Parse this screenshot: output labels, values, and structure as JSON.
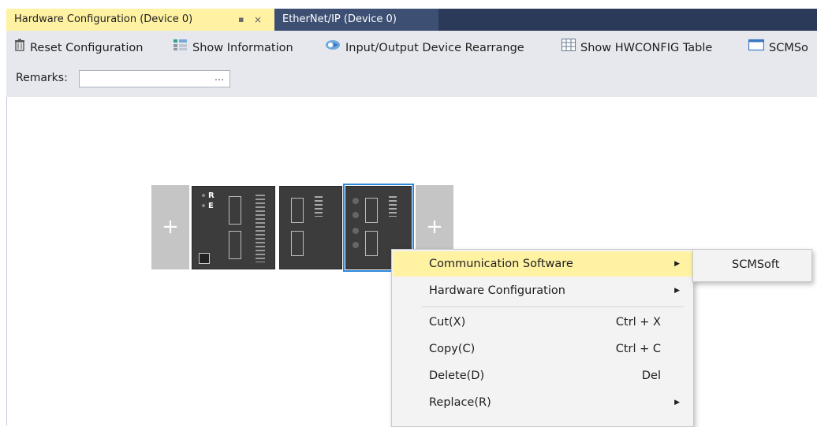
{
  "tabs": [
    {
      "label": "Hardware Configuration (Device 0)",
      "active": true,
      "pin": "▪",
      "close": "×"
    },
    {
      "label": "EtherNet/IP (Device 0)",
      "active": false
    }
  ],
  "toolbar": {
    "reset_label": "Reset Configuration",
    "show_info_label": "Show Information",
    "io_rearrange_label": "Input/Output Device Rearrange",
    "hwconfig_table_label": "Show HWCONFIG Table",
    "scmsoft_label": "SCMSo"
  },
  "remarks": {
    "label": "Remarks:",
    "value": "",
    "browse": "…"
  },
  "modules": {
    "add_glyph": "+",
    "cpu_leds": [
      "R",
      "E"
    ]
  },
  "context_menu": {
    "items": [
      {
        "label": "Communication Software",
        "shortcut": "",
        "submenu": true,
        "highlighted": true
      },
      {
        "label": "Hardware Configuration",
        "shortcut": "",
        "submenu": true
      },
      {
        "label": "Cut(X)",
        "shortcut": "Ctrl + X"
      },
      {
        "label": "Copy(C)",
        "shortcut": "Ctrl + C"
      },
      {
        "label": "Delete(D)",
        "shortcut": "Del"
      },
      {
        "label": "Replace(R)",
        "shortcut": "",
        "submenu": true
      }
    ],
    "arrow": "▶"
  },
  "submenu": {
    "items": [
      {
        "label": "SCMSoft"
      }
    ]
  },
  "colors": {
    "active_tab": "#fff2a3",
    "tab_strip": "#2b3a58",
    "selection": "#2a86d8",
    "highlight": "#fff2a3"
  }
}
